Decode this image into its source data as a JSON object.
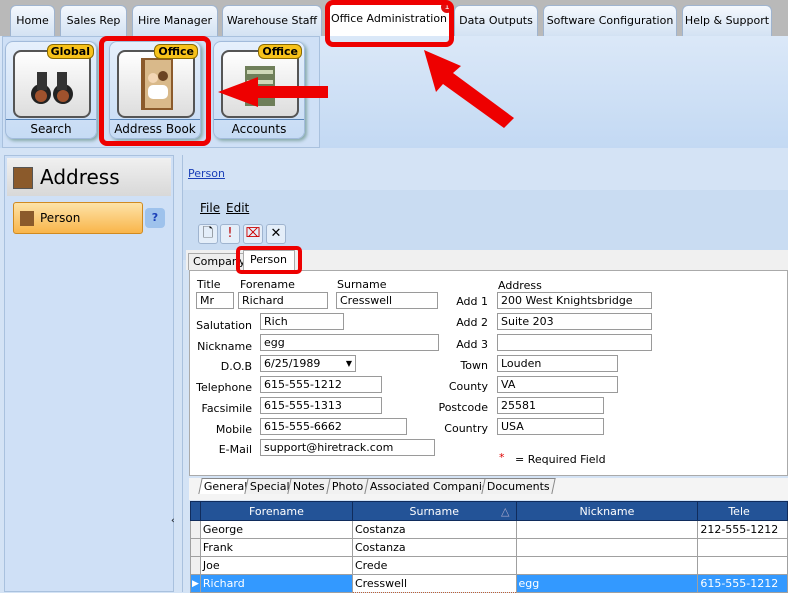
{
  "tabs": [
    "Home",
    "Sales Rep",
    "Hire Manager",
    "Warehouse Staff",
    "Office Administration",
    "Data Outputs",
    "Software Configuration",
    "Help & Support"
  ],
  "active_tab": "Office Administration",
  "active_tab_badge": "1",
  "ribbon": [
    {
      "label": "Search",
      "badge": "Global",
      "icon": "binoculars-icon"
    },
    {
      "label": "Address Book",
      "badge": "Office",
      "icon": "address-book-icon"
    },
    {
      "label": "Accounts",
      "badge": "Office",
      "icon": "money-stack-icon"
    }
  ],
  "left_panel": {
    "title": "Address",
    "items": [
      {
        "label": "Person"
      }
    ]
  },
  "breadcrumb": "Person",
  "menu": {
    "file": "File",
    "edit": "Edit"
  },
  "form_tabs": [
    "Company",
    "Person"
  ],
  "form": {
    "title_label": "Title",
    "title": "Mr",
    "forename_label": "Forename",
    "forename": "Richard",
    "surname_label": "Surname",
    "surname": "Cresswell",
    "salutation_label": "Salutation",
    "salutation": "Rich",
    "nickname_label": "Nickname",
    "nickname": "egg",
    "dob_label": "D.O.B",
    "dob": "6/25/1989",
    "telephone_label": "Telephone",
    "telephone": "615-555-1212",
    "facsimile_label": "Facsimile",
    "facsimile": "615-555-1313",
    "mobile_label": "Mobile",
    "mobile": "615-555-6662",
    "email_label": "E-Mail",
    "email": "support@hiretrack.com",
    "address_label": "Address",
    "add1_label": "Add 1",
    "add1": "200 West Knightsbridge",
    "add2_label": "Add 2",
    "add2": "Suite 203",
    "add3_label": "Add 3",
    "add3": "",
    "town_label": "Town",
    "town": "Louden",
    "county_label": "County",
    "county": "VA",
    "postcode_label": "Postcode",
    "postcode": "25581",
    "country_label": "Country",
    "country": "USA",
    "required_star": "*",
    "required_text": "= Required Field"
  },
  "sub_tabs": [
    "General",
    "Special",
    "Notes",
    "Photo",
    "Associated Companies",
    "Documents"
  ],
  "grid": {
    "columns": [
      "Forename",
      "Surname",
      "Nickname",
      "Tele"
    ],
    "sort_indicator": "△",
    "rows": [
      [
        "George",
        "Costanza",
        "",
        "212-555-1212"
      ],
      [
        "Frank",
        "Costanza",
        "",
        ""
      ],
      [
        "Joe",
        "Crede",
        "",
        ""
      ],
      [
        "Richard",
        "Cresswell",
        "egg",
        "615-555-1212"
      ]
    ],
    "selected_row": 3
  },
  "colors": {
    "annotation": "#ee0000",
    "grid_header": "#235397",
    "selection": "#3399ff",
    "badge": "#f7c21a"
  }
}
